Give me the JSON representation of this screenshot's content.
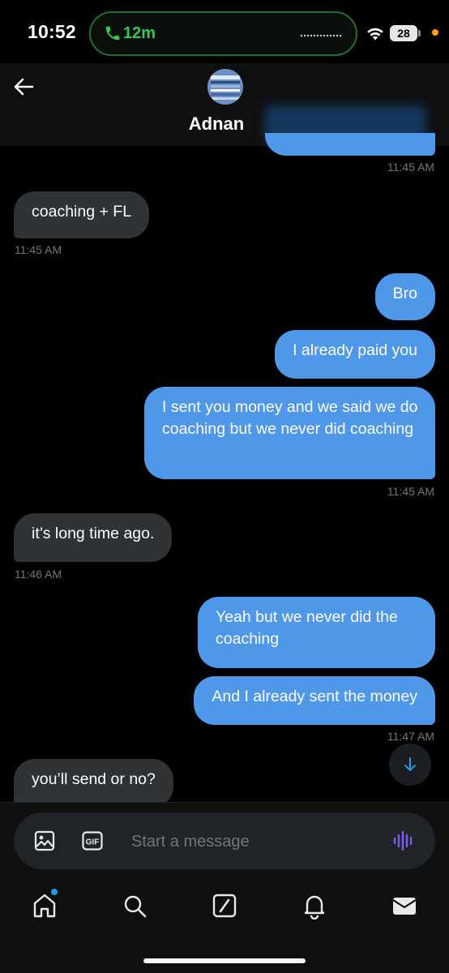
{
  "status_bar": {
    "time": "10:52",
    "call_duration": "12m",
    "battery": "28",
    "call_color": "#34c759"
  },
  "header": {
    "back_icon": "arrow-left-icon",
    "contact_name": "Adnan"
  },
  "messages": [
    {
      "direction": "outgoing",
      "text": "",
      "timestamp": "11:45 AM"
    },
    {
      "direction": "incoming",
      "text": "coaching + FL",
      "timestamp": "11:45 AM"
    },
    {
      "direction": "outgoing",
      "text": "Bro"
    },
    {
      "direction": "outgoing",
      "text": "I already paid you"
    },
    {
      "direction": "outgoing",
      "text": "I sent you money and we said we do coaching but we never did coaching",
      "timestamp": "11:45 AM"
    },
    {
      "direction": "incoming",
      "text": "it’s long time ago.",
      "timestamp": "11:46 AM"
    },
    {
      "direction": "outgoing",
      "text": "Yeah but we never did the coaching"
    },
    {
      "direction": "outgoing",
      "text": "And I already sent the money",
      "timestamp": "11:47 AM"
    },
    {
      "direction": "incoming",
      "text": "you’ll send or no?"
    }
  ],
  "composer": {
    "placeholder": "Start a message",
    "gif_label": "GIF",
    "value": ""
  },
  "tabs": [
    "home-icon",
    "search-icon",
    "grok-icon",
    "notifications-icon",
    "messages-icon"
  ],
  "colors": {
    "outgoing_bubble": "#4f97e8",
    "incoming_bubble": "#2f3336",
    "accent": "#1d9bf0",
    "voice": "#7f5af0"
  }
}
